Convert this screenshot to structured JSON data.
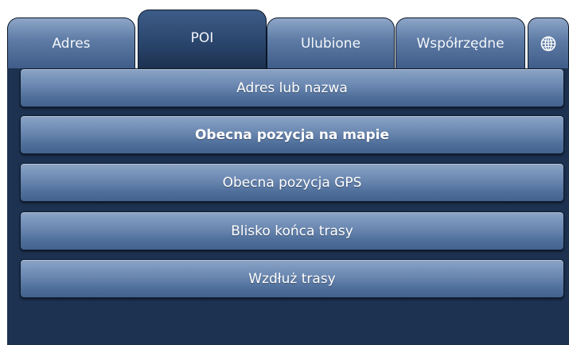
{
  "tabs": [
    {
      "label": "Adres",
      "active": false
    },
    {
      "label": "POI",
      "active": true
    },
    {
      "label": "Ulubione",
      "active": false
    },
    {
      "label": "Współrzędne",
      "active": false
    }
  ],
  "globe_tab": {
    "icon": "globe-icon"
  },
  "menu": {
    "items": [
      {
        "label": "Adres lub nazwa"
      },
      {
        "label": "Obecna pozycja na mapie"
      },
      {
        "label": "Obecna pozycja GPS"
      },
      {
        "label": "Blisko końca trasy"
      },
      {
        "label": "Wzdłuż trasy"
      }
    ]
  },
  "colors": {
    "panel_background": "#1d3150",
    "button_gradient_top": "#8ba4c6",
    "button_gradient_bottom": "#44628e",
    "active_tab": "#2c4870",
    "text": "#ffffff"
  }
}
